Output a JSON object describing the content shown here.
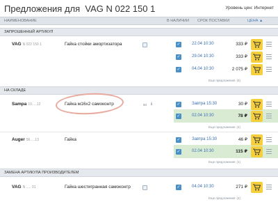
{
  "window": {
    "title_prefix": "Предложения для",
    "title_part": "VAG N 022 150 1",
    "price_level": "Уровень цен: Интернет"
  },
  "columns": {
    "name": "Наименование",
    "in_stock": "В наличии",
    "delivery": "Срок поставки",
    "price": "Цена ▲"
  },
  "sections": [
    {
      "label": "Запрошенный артикул"
    },
    {
      "label": "На складе"
    },
    {
      "label": "Замена артикула производителем"
    }
  ],
  "items": [
    {
      "brand": "VAG",
      "code": "N 022 150 1",
      "desc": "Гайка стойки амортизатора",
      "offers": [
        {
          "date": "22.04 10:30",
          "price": "333 ₽",
          "bold": false
        },
        {
          "date": "29.04 10:30",
          "price": "333 ₽",
          "bold": false
        },
        {
          "date": "04.04 10:30",
          "price": "2 075 ₽",
          "bold": false
        }
      ],
      "more": "Еще предложения",
      "more_count": "(5)"
    },
    {
      "brand": "Sampa",
      "code": "10.....12",
      "desc": "Гайка м16х2 самоконтр",
      "stock_badge": "50",
      "offers": [
        {
          "date": "Завтра 15:30",
          "price": "30 ₽",
          "bold": false
        },
        {
          "date": "02.04 10:30",
          "price": "78 ₽",
          "bold": true
        }
      ],
      "more": "Еще предложения",
      "more_count": "(4)"
    },
    {
      "brand": "Auger",
      "code": "56.....13",
      "desc": "Гайка",
      "offers": [
        {
          "date": "Завтра 15:30",
          "price": "46 ₽",
          "bold": false
        },
        {
          "date": "02.04 10:30",
          "price": "115 ₽",
          "bold": true
        }
      ],
      "more": "Еще предложения",
      "more_count": "(1)"
    },
    {
      "brand": "VAG",
      "code": "N ..... 01",
      "desc": "Гайка шестигранная самоконтр",
      "offers": [
        {
          "date": "04.04 10:30",
          "price": "271 ₽",
          "bold": false
        }
      ],
      "more": "Еще предложения",
      "more_count": "(4)"
    }
  ],
  "icons": {
    "checkbox": "check-icon",
    "cart": "cart-icon",
    "menu": "menu-icon",
    "stock": "warehouse-icon",
    "info": "info-icon"
  },
  "colors": {
    "accent": "#4a90c8",
    "cart": "#f5cf3c",
    "highlight": "#d9ecd3",
    "annotation": "#e8a99e"
  }
}
